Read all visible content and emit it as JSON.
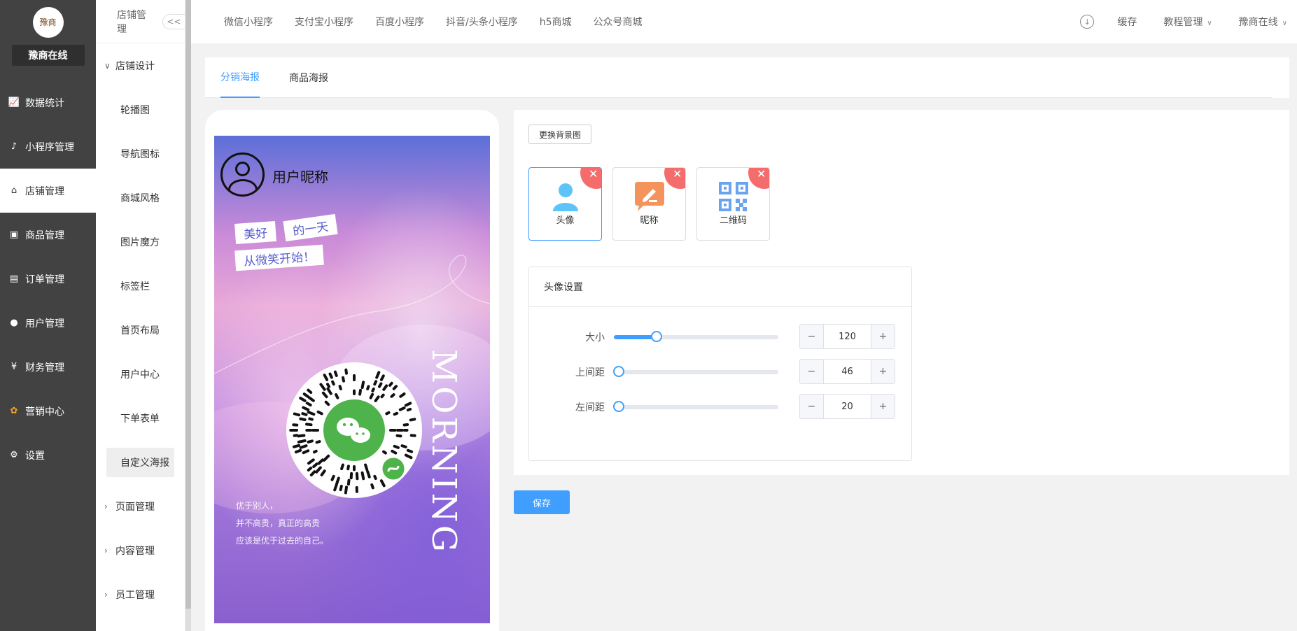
{
  "brand": {
    "logo_text": "豫商",
    "name": "豫商在线"
  },
  "main_menu": [
    {
      "label": "数据统计",
      "icon": "chart-line-icon"
    },
    {
      "label": "小程序管理",
      "icon": "link-icon"
    },
    {
      "label": "店铺管理",
      "icon": "store-icon",
      "active": true
    },
    {
      "label": "商品管理",
      "icon": "bag-icon"
    },
    {
      "label": "订单管理",
      "icon": "clipboard-icon"
    },
    {
      "label": "用户管理",
      "icon": "user-icon"
    },
    {
      "label": "财务管理",
      "icon": "finance-icon"
    },
    {
      "label": "营销中心",
      "icon": "marketing-icon"
    },
    {
      "label": "设置",
      "icon": "gear-icon"
    }
  ],
  "sub_sidebar": {
    "title": "店铺管理",
    "collapse_label": "<<",
    "group_open": "店铺设计",
    "items": [
      "轮播图",
      "导航图标",
      "商城风格",
      "图片魔方",
      "标签栏",
      "首页布局",
      "用户中心",
      "下单表单",
      "自定义海报"
    ],
    "active_item": "自定义海报",
    "groups_closed": [
      "页面管理",
      "内容管理",
      "员工管理"
    ]
  },
  "topbar": {
    "tabs": [
      "微信小程序",
      "支付宝小程序",
      "百度小程序",
      "抖音/头条小程序",
      "h5商城",
      "公众号商城"
    ],
    "cache_label": "缓存",
    "tutorial_label": "教程管理",
    "user_label": "豫商在线"
  },
  "content_tabs": {
    "items": [
      "分销海报",
      "商品海报"
    ],
    "active": "分销海报"
  },
  "poster": {
    "nickname": "用户昵称",
    "slogan": [
      "美好",
      "的一天",
      "从微笑开始！"
    ],
    "vertical_text": "MORNING",
    "poem": [
      "优于别人，",
      "并不高贵，真正的高贵",
      "应该是优于过去的自己。"
    ]
  },
  "settings": {
    "change_bg_label": "更换背景图",
    "elements": [
      {
        "label": "头像",
        "icon": "avatar-icon",
        "color": "#5ec4f7",
        "active": true
      },
      {
        "label": "昵称",
        "icon": "nickname-icon",
        "color": "#f5935c",
        "active": false
      },
      {
        "label": "二维码",
        "icon": "qrcode-icon",
        "color": "#6aa3ef",
        "active": false
      }
    ],
    "panel_title": "头像设置",
    "rows": [
      {
        "label": "大小",
        "value": "120",
        "slider_fraction": 0.26
      },
      {
        "label": "上间距",
        "value": "46",
        "slider_fraction": 0.03
      },
      {
        "label": "左间距",
        "value": "20",
        "slider_fraction": 0.03
      }
    ]
  },
  "save_label": "保存",
  "colors": {
    "accent": "#409eff",
    "sidebar": "#424242",
    "remove": "#f56c6c"
  }
}
